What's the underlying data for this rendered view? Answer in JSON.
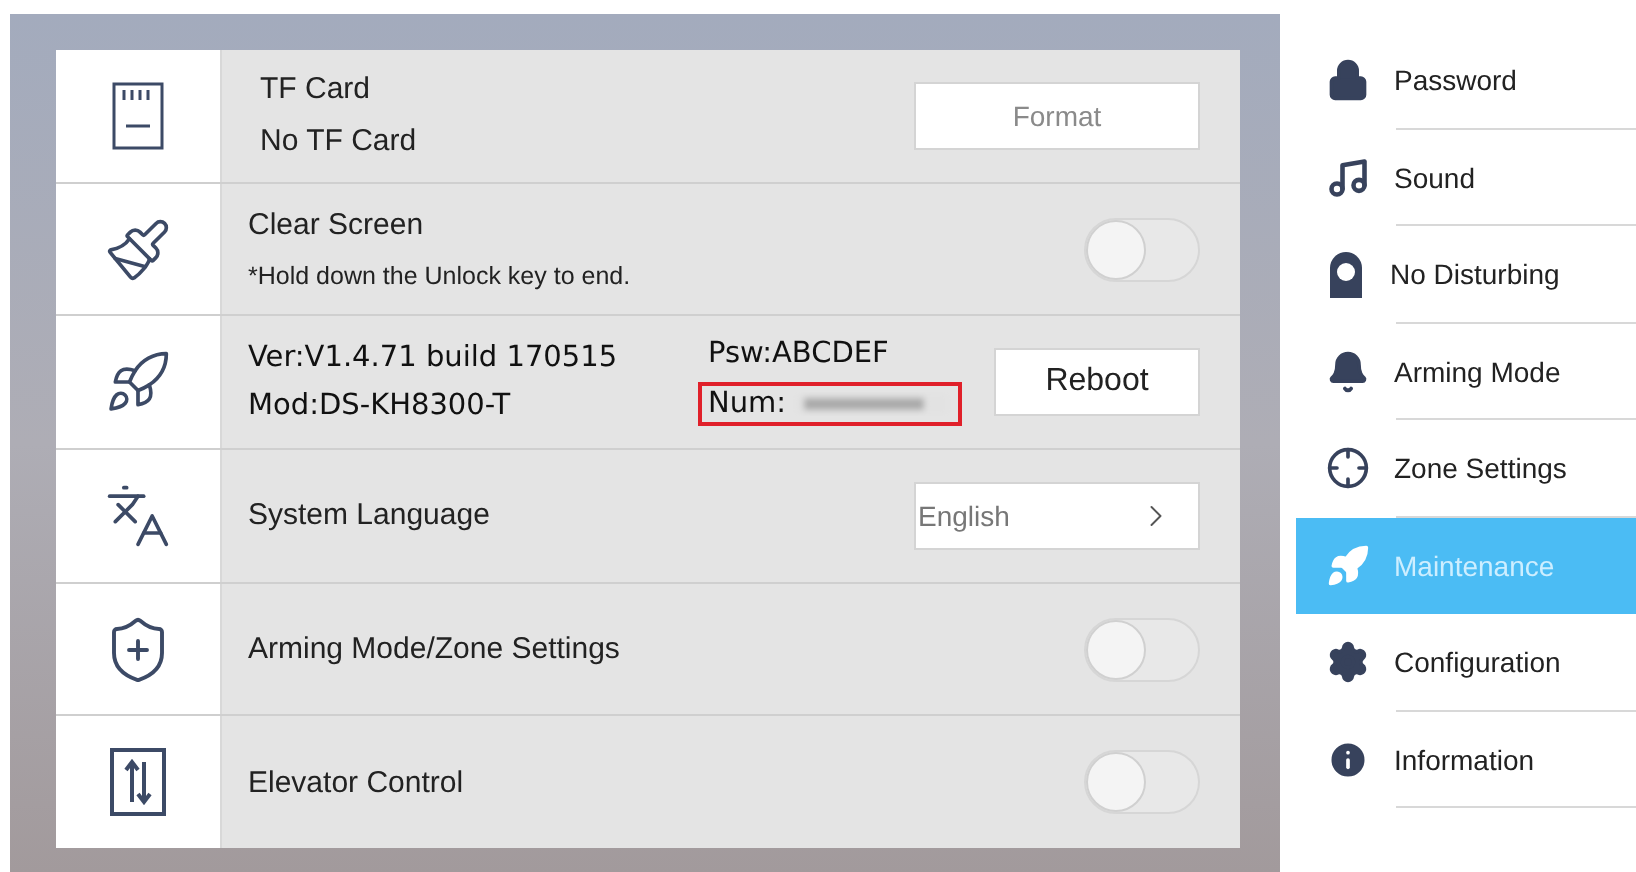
{
  "settings_rows": [
    {
      "kind": "action",
      "title": "TF Card",
      "subtitle": "No TF Card",
      "button": {
        "label": "Format",
        "disabled": true
      }
    },
    {
      "kind": "toggle",
      "title": "Clear Screen",
      "subtitle": "*Hold down the Unlock key to end.",
      "on": false
    },
    {
      "kind": "version",
      "version": "Ver:V1.4.71 build 170515",
      "model": "Mod:DS-KH8300-T",
      "password": "Psw:ABCDEF",
      "number_label": "Num:",
      "button": {
        "label": "Reboot",
        "disabled": false
      }
    },
    {
      "kind": "select",
      "title": "System Language",
      "value": "English"
    },
    {
      "kind": "toggle",
      "title": "Arming Mode/Zone Settings",
      "on": false
    },
    {
      "kind": "toggle",
      "title": "Elevator Control",
      "on": false
    }
  ],
  "sidebar": {
    "items": [
      {
        "label": "Password",
        "selected": false
      },
      {
        "label": "Sound",
        "selected": false
      },
      {
        "label": "No Disturbing",
        "selected": false
      },
      {
        "label": "Arming Mode",
        "selected": false
      },
      {
        "label": "Zone Settings",
        "selected": false
      },
      {
        "label": "Maintenance",
        "selected": true
      },
      {
        "label": "Configuration",
        "selected": false
      },
      {
        "label": "Information",
        "selected": false
      }
    ]
  }
}
